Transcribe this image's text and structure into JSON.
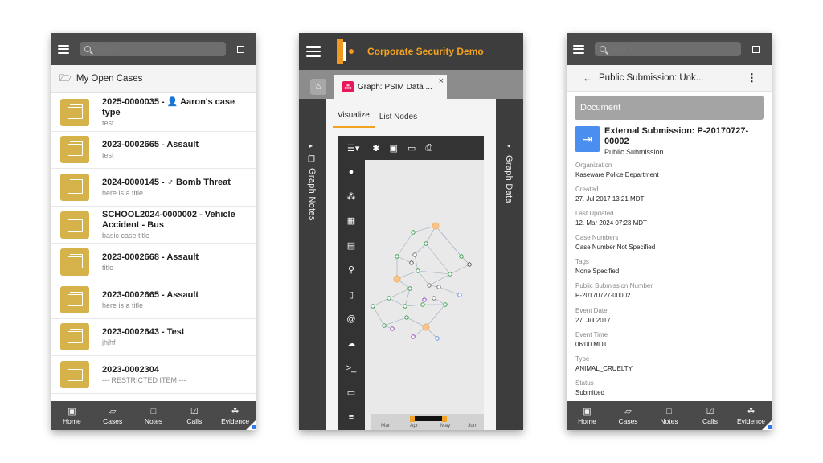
{
  "phone1": {
    "search_placeholder": "Search",
    "header": "My Open Cases",
    "cases": [
      {
        "title": "2025-0000035 - 👤 Aaron's case type",
        "subtitle": "test",
        "stacked": true
      },
      {
        "title": "2023-0002665 - Assault",
        "subtitle": "test",
        "stacked": true
      },
      {
        "title": "2024-0000145 - ♂ Bomb Threat",
        "subtitle": "here is a title",
        "stacked": true
      },
      {
        "title": "SCHOOL2024-0000002 - Vehicle Accident - Bus",
        "subtitle": "basic case title",
        "stacked": false
      },
      {
        "title": "2023-0002668 - Assault",
        "subtitle": "title",
        "stacked": true
      },
      {
        "title": "2023-0002665 - Assault",
        "subtitle": "here is a title",
        "stacked": true
      },
      {
        "title": "2023-0002643 - Test",
        "subtitle": "jhjhf",
        "stacked": true
      },
      {
        "title": "2023-0002304",
        "subtitle": "--- RESTRICTED ITEM ---",
        "stacked": false
      }
    ],
    "nav": [
      {
        "label": "Home",
        "icon": "▣",
        "name": "home"
      },
      {
        "label": "Cases",
        "icon": "▱",
        "name": "cases"
      },
      {
        "label": "Notes",
        "icon": "□",
        "name": "notes"
      },
      {
        "label": "Calls",
        "icon": "☑",
        "name": "calls"
      },
      {
        "label": "Evidence",
        "icon": "☘",
        "name": "evidence"
      }
    ]
  },
  "phone2": {
    "app_title": "Corporate Security Demo",
    "tab_label": "Graph: PSIM Data ...",
    "tab_close": "×",
    "left_panel": "Graph Notes",
    "right_panel": "Graph Data",
    "subtabs": [
      "Visualize",
      "List Nodes"
    ],
    "timeline_labels": [
      "Mar",
      "Apr",
      "May",
      "Jun"
    ]
  },
  "phone3": {
    "search_placeholder": "Search",
    "header": "Public Submission: Unk...",
    "doc_label": "Document",
    "title": "External Submission: P-20170727-00002",
    "type": "Public Submission",
    "fields": [
      {
        "label": "Organization",
        "value": "Kaseware Police Department"
      },
      {
        "label": "Created",
        "value": "27. Jul 2017 13:21 MDT"
      },
      {
        "label": "Last Updated",
        "value": "12. Mar 2024 07:23 MDT"
      },
      {
        "label": "Case Numbers",
        "value": "Case Number Not Specified"
      },
      {
        "label": "Tags",
        "value": "None Specified"
      },
      {
        "label": "Public Submission Number",
        "value": "P-20170727-00002"
      },
      {
        "label": "Event Date",
        "value": "27. Jul 2017"
      },
      {
        "label": "Event Time",
        "value": "06:00 MDT"
      },
      {
        "label": "Type",
        "value": "ANIMAL_CRUELTY"
      },
      {
        "label": "Status",
        "value": "Submitted"
      }
    ]
  },
  "colors": {
    "accent_orange": "#f2a321",
    "folder_gold": "#d6b34a",
    "dark_bar": "#4a4a4a",
    "doc_blue": "#4a8ef0"
  }
}
